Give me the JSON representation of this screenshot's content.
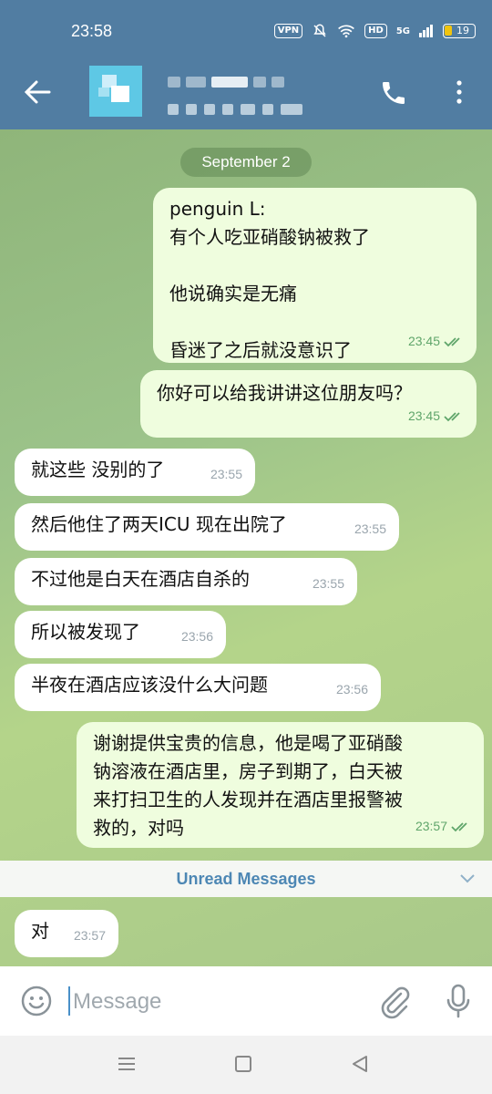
{
  "status_bar": {
    "time": "23:58",
    "vpn_label": "VPN",
    "hd_label": "HD",
    "network_label": "5G",
    "battery": "19"
  },
  "header": {
    "back_icon": "arrow-left-icon",
    "call_icon": "phone-icon",
    "more_icon": "more-vertical-icon"
  },
  "chat": {
    "date_label": "September 2",
    "messages": [
      {
        "dir": "out",
        "text": "penguin L:\n有个人吃亚硝酸钠被救了\n\n他说确实是无痛\n\n昏迷了之后就没意识了",
        "time": "23:45"
      },
      {
        "dir": "out",
        "text": "你好可以给我讲讲这位朋友吗？",
        "time": "23:45"
      },
      {
        "dir": "in",
        "text": "就这些 没别的了",
        "time": "23:55"
      },
      {
        "dir": "in",
        "text": "然后他住了两天ICU 现在出院了",
        "time": "23:55"
      },
      {
        "dir": "in",
        "text": "不过他是白天在酒店自杀的",
        "time": "23:55"
      },
      {
        "dir": "in",
        "text": "所以被发现了",
        "time": "23:56"
      },
      {
        "dir": "in",
        "text": "半夜在酒店应该没什么大问题",
        "time": "23:56"
      },
      {
        "dir": "out",
        "text": "谢谢提供宝贵的信息，他是喝了亚硝酸\n钠溶液在酒店里，房子到期了，白天被\n来打扫卫生的人发现并在酒店里报警被\n救的，对吗",
        "time": "23:57"
      },
      {
        "dir": "in",
        "text": "对",
        "time": "23:57"
      }
    ],
    "unread_label": "Unread Messages"
  },
  "input": {
    "placeholder": "Message"
  },
  "colors": {
    "header": "#517da2",
    "outgoing_bubble": "#effdde",
    "incoming_bubble": "#ffffff",
    "read_ticks": "#5fa56a"
  }
}
